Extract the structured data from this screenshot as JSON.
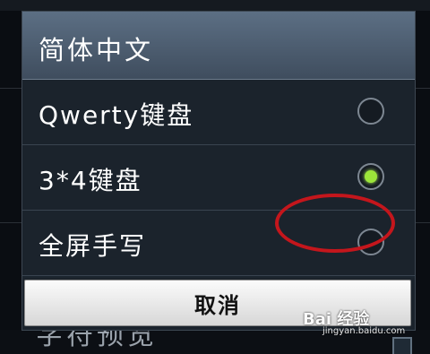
{
  "dialog": {
    "title": "简体中文",
    "options": [
      {
        "label": "Qwerty键盘",
        "selected": false
      },
      {
        "label": "3*4键盘",
        "selected": true
      },
      {
        "label": "全屏手写",
        "selected": false,
        "highlighted": true
      }
    ],
    "cancel_label": "取消"
  },
  "background": {
    "bottom_item_label": "字符预览",
    "bottom_item_checked": true
  },
  "watermark": {
    "main": "Bai 经验",
    "sub": "jingyan.baidu.com"
  },
  "colors": {
    "header": "#4e5f72",
    "selected_dot": "#9ce63a",
    "annotation_circle": "#c4161c",
    "cancel_button": "#eeeeee"
  }
}
